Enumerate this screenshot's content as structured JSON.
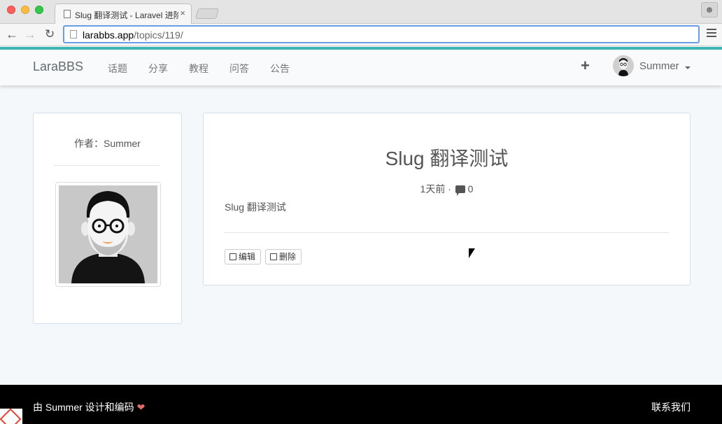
{
  "browser": {
    "tab_title": "Slug 翻译测试 - Laravel 进阶",
    "tab_close": "×",
    "url_host": "larabbs.app",
    "url_path": "/topics/119/"
  },
  "navbar": {
    "brand": "LaraBBS",
    "items": [
      {
        "label": "话题"
      },
      {
        "label": "分享"
      },
      {
        "label": "教程"
      },
      {
        "label": "问答"
      },
      {
        "label": "公告"
      }
    ],
    "plus": "+",
    "username": "Summer"
  },
  "author": {
    "label": "作者：Summer"
  },
  "topic": {
    "title": "Slug 翻译测试",
    "time": "1天前",
    "separator": " · ",
    "reply_count": "0",
    "body": "Slug 翻译测试",
    "edit_label": "编辑",
    "delete_label": "删除"
  },
  "footer": {
    "credit_prefix": "由 Summer 设计和编码 ",
    "heart": "❤",
    "contact": "联系我们"
  }
}
